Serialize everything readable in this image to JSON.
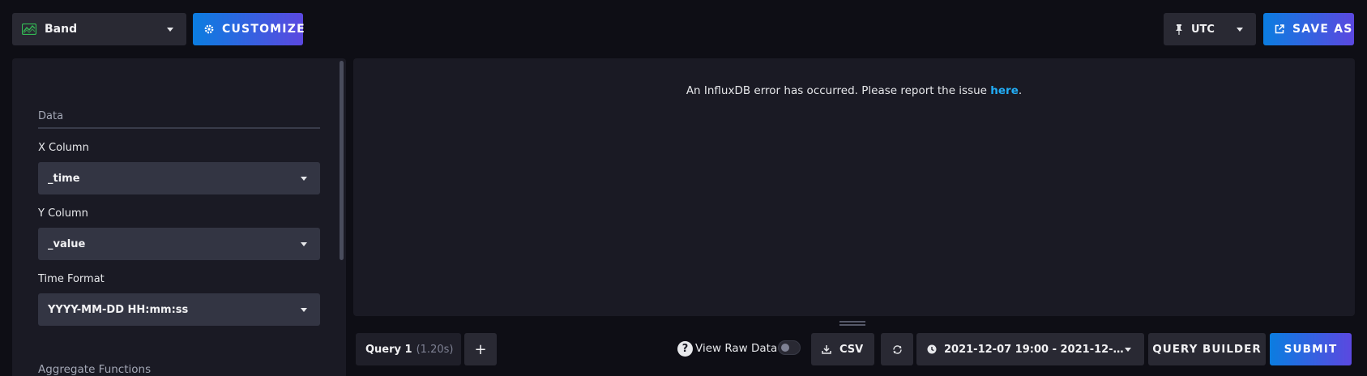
{
  "toolbar": {
    "viz_type": "Band",
    "customize_label": "CUSTOMIZE",
    "timezone": "UTC",
    "save_as_label": "SAVE AS"
  },
  "sidebar": {
    "section_data": "Data",
    "x_column": {
      "label": "X Column",
      "value": "_time"
    },
    "y_column": {
      "label": "Y Column",
      "value": "_value"
    },
    "time_format": {
      "label": "Time Format",
      "value": "YYYY-MM-DD HH:mm:ss"
    },
    "section_aggregate": "Aggregate Functions"
  },
  "main": {
    "error_prefix": "An InfluxDB error has occurred. Please report the issue ",
    "error_link": "here",
    "error_suffix": "."
  },
  "query_bar": {
    "query_tab": "Query 1",
    "query_time": "(1.20s)",
    "add_label": "+",
    "view_raw_label": "View Raw Data",
    "csv_label": "CSV",
    "time_range": "2021-12-07 19:00 - 2021-12-…",
    "query_builder_label": "QUERY BUILDER",
    "submit_label": "SUBMIT"
  },
  "colors": {
    "background": "#0e0e15",
    "panel": "#1a1a24",
    "button_dark": "#292933",
    "accent_start": "#0b7de0",
    "accent_end": "#5b48e0",
    "link": "#22adf6",
    "band_icon": "#34bb55"
  },
  "icons": {
    "viz": "band-chart-icon",
    "customize": "gear-icon",
    "timezone": "pin-icon",
    "save_as": "external-link-icon",
    "help": "question-circle-icon",
    "csv": "download-icon",
    "refresh": "refresh-icon",
    "time_range": "clock-icon"
  }
}
